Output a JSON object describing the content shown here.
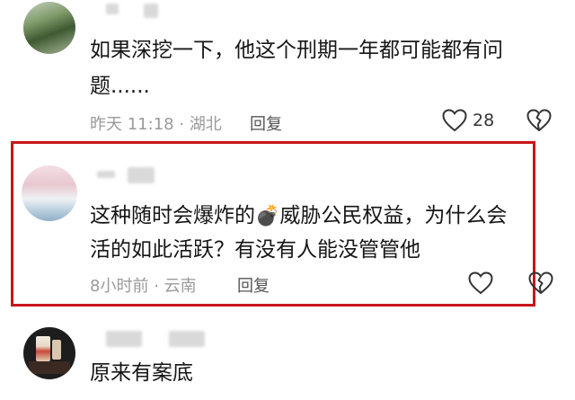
{
  "comments": [
    {
      "text_line1": "如果深挖一下，他这个刑期一年都可能都有问",
      "text_line2": "题......",
      "time": "昨天 11:18",
      "sep": "·",
      "location": "湖北",
      "reply_label": "回复",
      "like_count": "28"
    },
    {
      "text_part1": "这种随时会爆炸的",
      "bomb_emoji": "💣",
      "text_part2": "威胁公民权益，为什么会",
      "text_line2": "活的如此活跃？有没有人能没管管他",
      "time": "8小时前",
      "sep": "·",
      "location": "云南",
      "reply_label": "回复"
    },
    {
      "text": "原来有案底"
    }
  ],
  "colors": {
    "highlight": "#c9151a"
  }
}
